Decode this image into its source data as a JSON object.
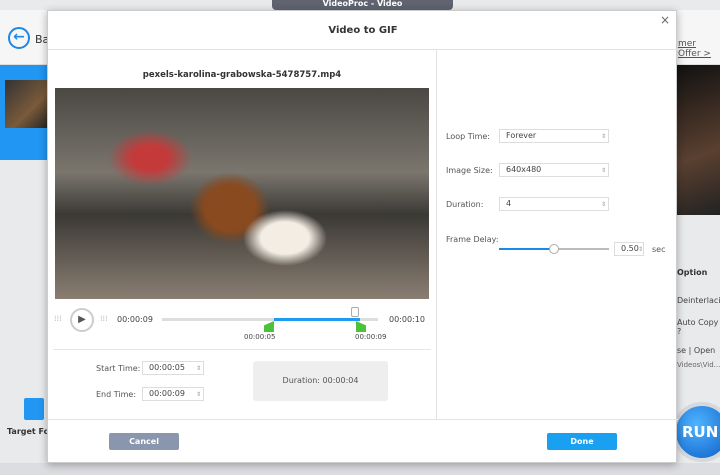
{
  "app": {
    "title": "VideoProc - Video",
    "back_label": "Ba",
    "offer_link": "mer Offer >",
    "option_label": "Option",
    "deinterlacing": "Deinterlacing",
    "auto_copy": "Auto Copy ?",
    "browse": "se",
    "open": "Open",
    "output_path": "Videos\\Vid...",
    "run": "RUN",
    "target_format": "Target For"
  },
  "dialog": {
    "title": "Video to GIF",
    "close": "×",
    "filename": "pexels-karolina-grabowska-5478757.mp4",
    "player": {
      "current_time": "00:00:09",
      "total_time": "00:00:10",
      "start_marker": "00:00:05",
      "end_marker": "00:00:09",
      "play_icon": "▶",
      "grip": "⁞⁞⁞"
    },
    "start_time_label": "Start Time:",
    "start_time": "00:00:05",
    "end_time_label": "End Time:",
    "end_time": "00:00:09",
    "duration_text": "Duration: 00:00:04",
    "settings": {
      "loop_label": "Loop Time:",
      "loop_value": "Forever",
      "size_label": "Image Size:",
      "size_value": "640x480",
      "duration_label": "Duration:",
      "duration_value": "4",
      "delay_label": "Frame Delay:",
      "delay_value": "0.50",
      "delay_unit": "sec",
      "delay_slider_fraction": 0.5
    },
    "cancel": "Cancel",
    "done": "Done"
  }
}
